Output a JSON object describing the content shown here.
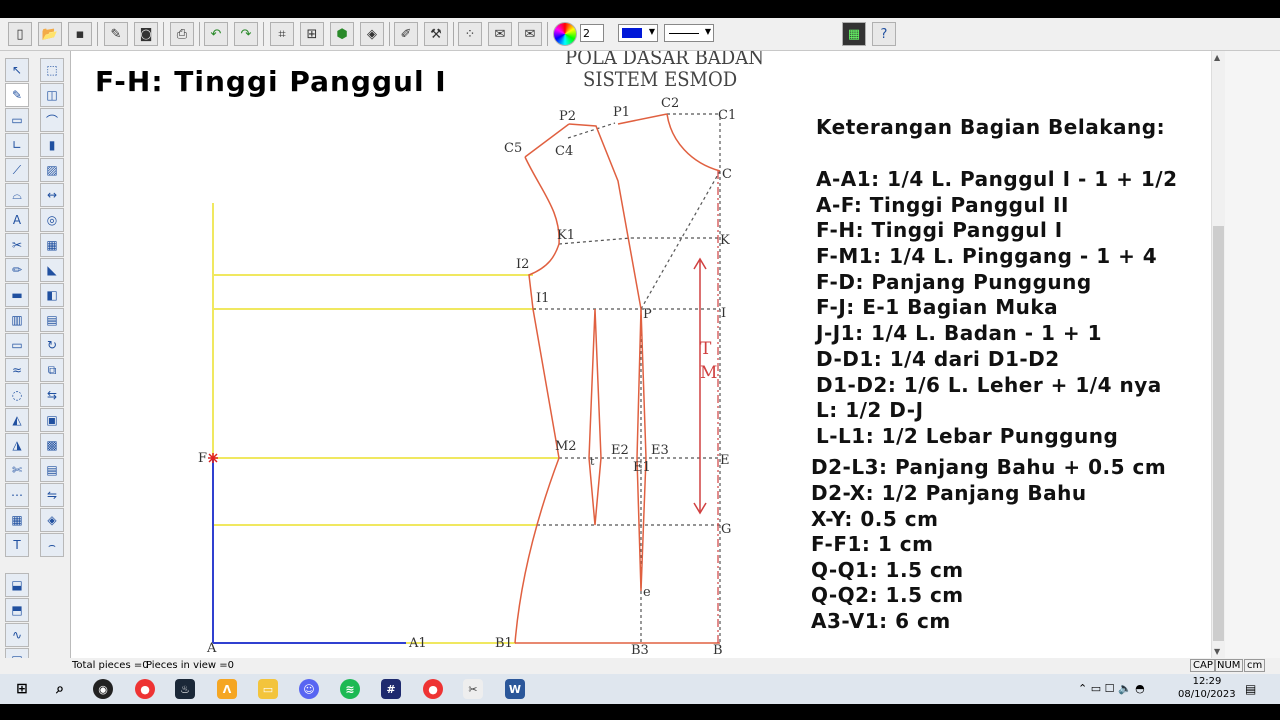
{
  "toolbar": {
    "color_index_value": "2",
    "icons": [
      "new-icon",
      "open-icon",
      "save-icon",
      "eraser-icon",
      "camera-icon",
      "print-icon",
      "undo-icon",
      "redo-icon",
      "grid-icon",
      "grid-2-icon",
      "shape-icon",
      "fill-icon",
      "brush-icon",
      "tool-icon",
      "points-icon",
      "mail-icon",
      "mail-2-icon",
      "color-wheel-icon"
    ],
    "color_swatch": "#0018d8",
    "right_icons": [
      "film-icon",
      "help-icon"
    ]
  },
  "title": "F-H: Tinggi Panggul I",
  "diagram_title_line1": "POLA DASAR BADAN",
  "diagram_title_line2": "SISTEM ESMOD",
  "legend": {
    "heading": "Keterangan Bagian Belakang:",
    "lines": [
      "A-A1: 1/4 L. Panggul I - 1 + 1/2",
      "A-F: Tinggi Panggul II",
      "F-H: Tinggi Panggul I",
      "F-M1: 1/4 L. Pinggang - 1 + 4",
      "F-D: Panjang Punggung",
      "F-J: E-1 Bagian Muka",
      "J-J1: 1/4 L. Badan - 1 + 1",
      "D-D1: 1/4 dari D1-D2",
      "D1-D2: 1/6 L. Leher + 1/4 nya",
      "L: 1/2 D-J",
      "L-L1: 1/2 Lebar Punggung",
      "D2-L3: Panjang Bahu + 0.5 cm",
      "D2-X: 1/2 Panjang Bahu",
      "X-Y: 0.5 cm",
      "F-F1: 1 cm",
      "Q-Q1: 1.5 cm",
      "Q-Q2: 1.5 cm",
      "A3-V1: 6 cm"
    ]
  },
  "points": {
    "A": "A",
    "A1": "A1",
    "B1": "B1",
    "B3": "B3",
    "B": "B",
    "F": "F",
    "C1": "C1",
    "C": "C",
    "C2": "C2",
    "P1": "P1",
    "P2": "P2",
    "C4": "C4",
    "C5": "C5",
    "K1": "K1",
    "K": "K",
    "I2": "I2",
    "I1": "I1",
    "P": "P",
    "I": "I",
    "M2": "M2",
    "E2": "E2",
    "E3": "E3",
    "E1": "E1",
    "E": "E",
    "t": "t",
    "G": "G",
    "e": "e",
    "T": "T",
    "M": "M"
  },
  "status": {
    "total_pieces": "Total pieces =0",
    "pieces_in_view": "Pieces in view =0",
    "cap": "CAP",
    "num": "NUM",
    "unit": "cm"
  },
  "taskbar": {
    "time": "12:29",
    "date": "08/10/2023"
  },
  "colors": {
    "pattern_line": "#e06040",
    "guide_yellow": "#f0e860",
    "axis_blue": "#3040d0",
    "dotted": "#555555",
    "arrow_red": "#d04040"
  }
}
